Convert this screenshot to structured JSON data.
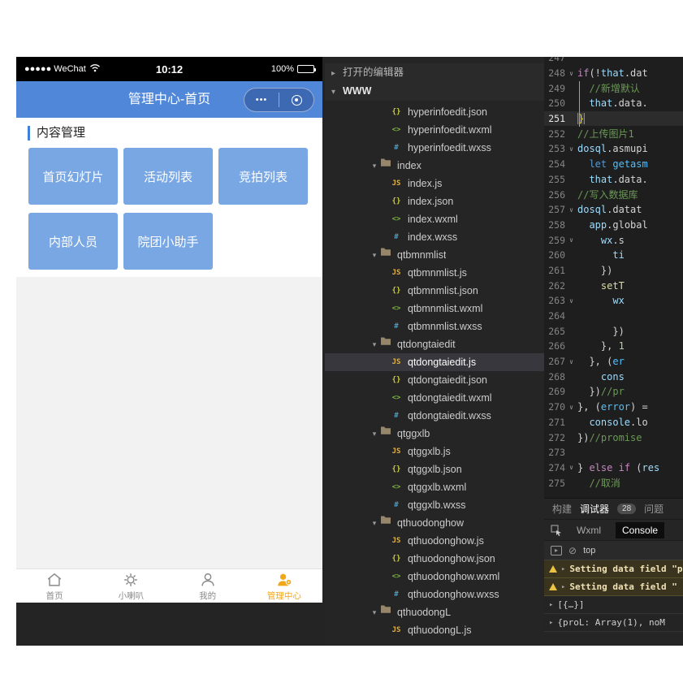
{
  "colors": {
    "nav_blue": "#5187d8",
    "button_blue": "#79a7e3",
    "section_marker_blue": "#4080d9",
    "tabbar_active_orange": "#f0a818",
    "statusbar_black": "#000000"
  },
  "phone": {
    "status": {
      "carrier": "●●●●● WeChat",
      "time": "10:12",
      "battery_pct": "100%"
    },
    "nav": {
      "title": "管理中心-首页",
      "menu_dots": "•••"
    },
    "content": {
      "section_title": "内容管理",
      "buttons": [
        "首页幻灯片",
        "活动列表",
        "竞拍列表",
        "内部人员",
        "院团小助手"
      ]
    },
    "tabbar": [
      {
        "label": "首页",
        "icon": "home-icon",
        "active": false
      },
      {
        "label": "小喇叭",
        "icon": "speaker-icon",
        "active": false
      },
      {
        "label": "我的",
        "icon": "person-icon",
        "active": false
      },
      {
        "label": "管理中心",
        "icon": "admin-icon",
        "active": true
      }
    ]
  },
  "explorer": {
    "open_editors": "打开的编辑器",
    "root": "WWW",
    "glyphs": {
      "collapsed": "▸",
      "expanded": "▾"
    },
    "items": [
      {
        "name": "hyperinfoedit.json",
        "type": "json"
      },
      {
        "name": "hyperinfoedit.wxml",
        "type": "wxml"
      },
      {
        "name": "hyperinfoedit.wxss",
        "type": "wxss"
      },
      {
        "name": "index",
        "type": "folder"
      },
      {
        "name": "index.js",
        "type": "js"
      },
      {
        "name": "index.json",
        "type": "json"
      },
      {
        "name": "index.wxml",
        "type": "wxml"
      },
      {
        "name": "index.wxss",
        "type": "wxss"
      },
      {
        "name": "qtbmnmlist",
        "type": "folder"
      },
      {
        "name": "qtbmnmlist.js",
        "type": "js"
      },
      {
        "name": "qtbmnmlist.json",
        "type": "json"
      },
      {
        "name": "qtbmnmlist.wxml",
        "type": "wxml"
      },
      {
        "name": "qtbmnmlist.wxss",
        "type": "wxss"
      },
      {
        "name": "qtdongtaiedit",
        "type": "folder"
      },
      {
        "name": "qtdongtaiedit.js",
        "type": "js",
        "selected": true
      },
      {
        "name": "qtdongtaiedit.json",
        "type": "json"
      },
      {
        "name": "qtdongtaiedit.wxml",
        "type": "wxml"
      },
      {
        "name": "qtdongtaiedit.wxss",
        "type": "wxss"
      },
      {
        "name": "qtggxlb",
        "type": "folder"
      },
      {
        "name": "qtggxlb.js",
        "type": "js"
      },
      {
        "name": "qtggxlb.json",
        "type": "json"
      },
      {
        "name": "qtggxlb.wxml",
        "type": "wxml"
      },
      {
        "name": "qtggxlb.wxss",
        "type": "wxss"
      },
      {
        "name": "qthuodonghow",
        "type": "folder"
      },
      {
        "name": "qthuodonghow.js",
        "type": "js"
      },
      {
        "name": "qthuodonghow.json",
        "type": "json"
      },
      {
        "name": "qthuodonghow.wxml",
        "type": "wxml"
      },
      {
        "name": "qthuodonghow.wxss",
        "type": "wxss"
      },
      {
        "name": "qthuodongL",
        "type": "folder"
      },
      {
        "name": "qthuodongL.js",
        "type": "js"
      }
    ]
  },
  "editor": {
    "current_line": 251,
    "fold_glyph": "∨",
    "lines": [
      {
        "n": 247,
        "segs": []
      },
      {
        "n": 248,
        "fold": true,
        "segs": [
          [
            "if",
            "kw"
          ],
          [
            "(!",
            "fg"
          ],
          [
            "that",
            "var"
          ],
          [
            ".dat",
            "fg"
          ]
        ]
      },
      {
        "n": 249,
        "segs": [
          [
            "  //新增默认",
            "com"
          ]
        ]
      },
      {
        "n": 250,
        "segs": [
          [
            "  ",
            "fg"
          ],
          [
            "that",
            "var"
          ],
          [
            ".data.",
            "fg"
          ]
        ]
      },
      {
        "n": 251,
        "segs": [
          [
            "}",
            "brk"
          ]
        ]
      },
      {
        "n": 252,
        "segs": [
          [
            "//上传图片1",
            "com"
          ]
        ]
      },
      {
        "n": 253,
        "fold": true,
        "segs": [
          [
            "dosql",
            "var"
          ],
          [
            ".asmupi",
            "fg"
          ]
        ]
      },
      {
        "n": 254,
        "segs": [
          [
            "  ",
            "fg"
          ],
          [
            "let",
            "kw2"
          ],
          [
            " ",
            "fg"
          ],
          [
            "getasm",
            "var2"
          ]
        ]
      },
      {
        "n": 255,
        "segs": [
          [
            "  ",
            "fg"
          ],
          [
            "that",
            "var"
          ],
          [
            ".data.",
            "fg"
          ]
        ]
      },
      {
        "n": 256,
        "segs": [
          [
            "//写入数据库",
            "com"
          ]
        ]
      },
      {
        "n": 257,
        "fold": true,
        "segs": [
          [
            "dosql",
            "var"
          ],
          [
            ".datat",
            "fg"
          ]
        ]
      },
      {
        "n": 258,
        "segs": [
          [
            "  ",
            "fg"
          ],
          [
            "app",
            "var"
          ],
          [
            ".global",
            "fg"
          ]
        ]
      },
      {
        "n": 259,
        "fold": true,
        "segs": [
          [
            "    ",
            "fg"
          ],
          [
            "wx",
            "var"
          ],
          [
            ".s",
            "fg"
          ]
        ]
      },
      {
        "n": 260,
        "segs": [
          [
            "      ",
            "fg"
          ],
          [
            "ti",
            "var"
          ]
        ]
      },
      {
        "n": 261,
        "segs": [
          [
            "    })",
            "fg"
          ]
        ]
      },
      {
        "n": 262,
        "segs": [
          [
            "    ",
            "fg"
          ],
          [
            "setT",
            "fn"
          ]
        ]
      },
      {
        "n": 263,
        "fold": true,
        "segs": [
          [
            "      ",
            "fg"
          ],
          [
            "wx",
            "var"
          ]
        ]
      },
      {
        "n": 264,
        "segs": []
      },
      {
        "n": 265,
        "segs": [
          [
            "      })",
            "fg"
          ]
        ]
      },
      {
        "n": 266,
        "segs": [
          [
            "    }, ",
            "fg"
          ],
          [
            "1",
            "num"
          ]
        ]
      },
      {
        "n": 267,
        "fold": true,
        "segs": [
          [
            "  }, (",
            "fg"
          ],
          [
            "er",
            "var2"
          ]
        ]
      },
      {
        "n": 268,
        "segs": [
          [
            "    ",
            "fg"
          ],
          [
            "cons",
            "var"
          ]
        ]
      },
      {
        "n": 269,
        "segs": [
          [
            "  })",
            "fg"
          ],
          [
            "//pr",
            "com"
          ]
        ]
      },
      {
        "n": 270,
        "fold": true,
        "segs": [
          [
            "}, (",
            "fg"
          ],
          [
            "error",
            "var2"
          ],
          [
            ") =",
            "fg"
          ]
        ]
      },
      {
        "n": 271,
        "segs": [
          [
            "  ",
            "fg"
          ],
          [
            "console",
            "var"
          ],
          [
            ".lo",
            "fg"
          ]
        ]
      },
      {
        "n": 272,
        "segs": [
          [
            "})",
            "fg"
          ],
          [
            "//promise",
            "com"
          ]
        ]
      },
      {
        "n": 273,
        "segs": []
      },
      {
        "n": 274,
        "fold": true,
        "segs": [
          [
            "} ",
            "fg"
          ],
          [
            "else",
            "kw"
          ],
          [
            " ",
            "fg"
          ],
          [
            "if",
            "kw"
          ],
          [
            " (",
            "fg"
          ],
          [
            "res",
            "var"
          ]
        ]
      },
      {
        "n": 275,
        "segs": [
          [
            "  //取消",
            "com"
          ]
        ]
      }
    ]
  },
  "debug": {
    "tabs": [
      {
        "label": "构建",
        "active": false
      },
      {
        "label": "调试器",
        "badge": "28",
        "active": true
      },
      {
        "label": "问题",
        "active": false
      }
    ],
    "subtabs": [
      {
        "label": "Wxml",
        "active": false
      },
      {
        "label": "Console",
        "active": true
      }
    ],
    "context_value": "top",
    "console": [
      {
        "kind": "warning",
        "text": "Setting data field \"p"
      },
      {
        "kind": "warning",
        "text": "Setting data field \""
      },
      {
        "kind": "log",
        "text": "[{…}]"
      },
      {
        "kind": "log",
        "text": "{proL: Array(1), noM"
      }
    ]
  }
}
